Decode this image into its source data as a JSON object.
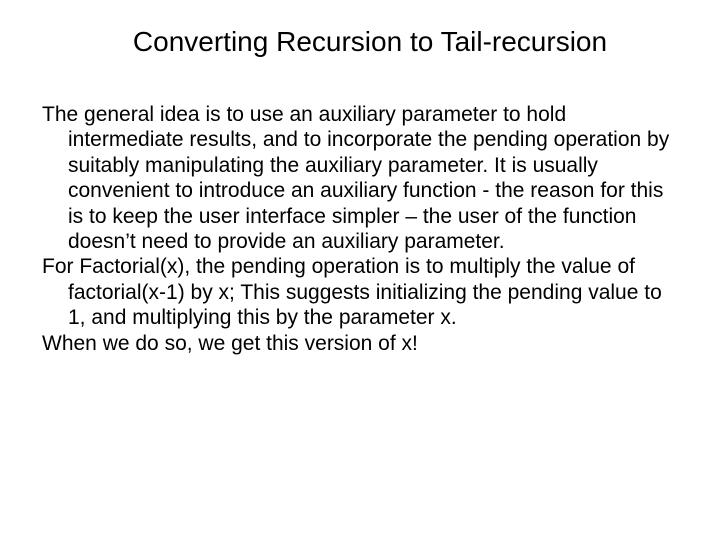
{
  "slide": {
    "title": "Converting Recursion to Tail-recursion",
    "p1": "The general idea is to use an auxiliary parameter to hold intermediate results, and to incorporate the pending operation by suitably manipulating the auxiliary parameter. It is usually convenient to introduce an auxiliary function - the reason for this is to keep the user interface simpler – the user of the function doesn’t need to provide an auxiliary parameter.",
    "p2": "For Factorial(x), the pending operation is to multiply the value of factorial(x-1) by x; This suggests initializing the pending value to 1, and multiplying this by the parameter x.",
    "p3": "When we do so, we get this version of x!"
  }
}
